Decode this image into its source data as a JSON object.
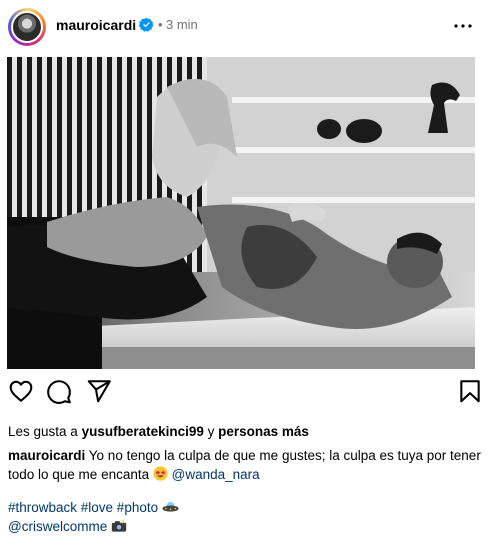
{
  "header": {
    "username": "mauroicardi",
    "dot": "•",
    "time": "3 min",
    "verified_icon": "verified-badge-icon",
    "more_icon": "more-options-icon"
  },
  "post": {
    "image_alt": "Foto en blanco y negro de una pareja tumbada sobre una mesa de mármol"
  },
  "actions": {
    "icons": [
      "heart-icon",
      "comment-icon",
      "share-icon",
      "bookmark-icon"
    ]
  },
  "likes": {
    "prefix": "Les gusta a ",
    "user": "yusufberatekinci99",
    "middle": " y ",
    "others": "personas más"
  },
  "caption": {
    "user": "mauroicardi",
    "text": " Yo no tengo la culpa de que me gustes; la culpa es tuya por tener todo lo que me encanta ",
    "mention": "@wanda_nara",
    "hashtags": "#throwback #love #photo",
    "credit": "@criswelcomme"
  },
  "colors": {
    "link": "#00376b",
    "muted": "#737373",
    "verified": "#0095f6"
  }
}
